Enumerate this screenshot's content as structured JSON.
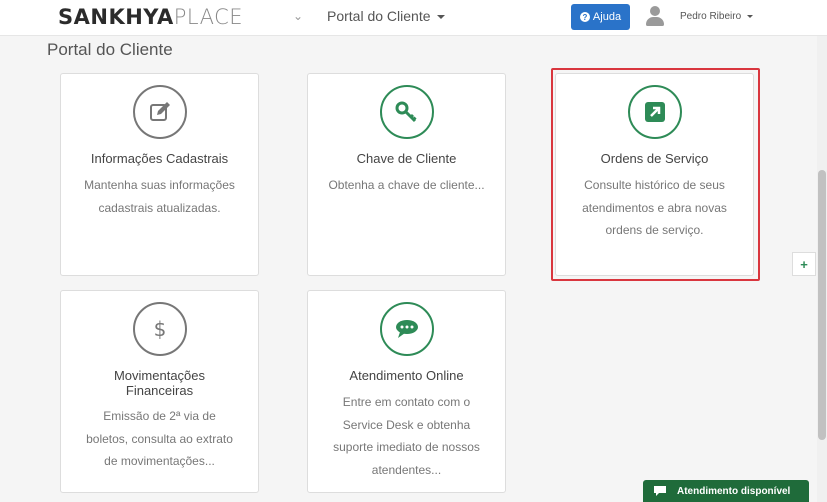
{
  "header": {
    "brand_bold": "SANKHYA",
    "brand_light": "PLACE",
    "portal_menu": "Portal do Cliente",
    "help_label": "Ajuda",
    "user_name": "Pedro Ribeiro"
  },
  "page": {
    "title": "Portal do Cliente"
  },
  "cards": [
    {
      "title": "Informações Cadastrais",
      "desc_lines": [
        "Mantenha suas informações",
        "cadastrais atualizadas."
      ],
      "icon": "edit-icon"
    },
    {
      "title": "Chave de Cliente",
      "desc_lines": [
        "Obtenha a chave de cliente..."
      ],
      "icon": "key-icon"
    },
    {
      "title": "Ordens de Serviço",
      "desc_lines": [
        "Consulte histórico de seus",
        "atendimentos e abra novas",
        "ordens de serviço."
      ],
      "icon": "external-link-icon"
    },
    {
      "title_lines": [
        "Movimentações",
        "Financeiras"
      ],
      "desc_lines": [
        "Emissão de 2ª via de",
        "boletos, consulta ao extrato",
        "de movimentações..."
      ],
      "icon": "dollar-icon"
    },
    {
      "title": "Atendimento Online",
      "desc_lines": [
        "Entre em contato com o",
        "Service Desk e obtenha",
        "suporte imediato de nossos",
        "atendentes..."
      ],
      "icon": "chat-icon"
    }
  ],
  "side_button": "+",
  "chat": {
    "label": "Atendimento disponível"
  },
  "colors": {
    "accent_green": "#2e8b57",
    "help_blue": "#2a73c9",
    "highlight_red": "#d9363e",
    "chat_green": "#1f6b3a"
  }
}
